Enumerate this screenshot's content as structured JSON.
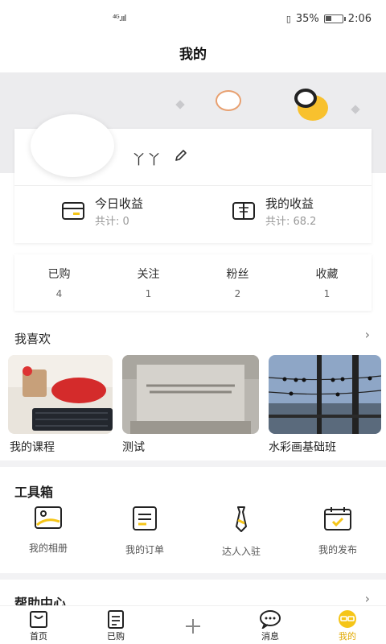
{
  "status": {
    "signal": "⁴ᴳ.ııl",
    "battery": "35%",
    "time": "2:06"
  },
  "header": {
    "title": "我的"
  },
  "profile": {
    "username": "丫丫",
    "today_earnings": {
      "title": "今日收益",
      "subtitle": "共计: 0"
    },
    "my_earnings": {
      "title": "我的收益",
      "subtitle": "共计: 68.2"
    }
  },
  "stats": [
    {
      "label": "已购",
      "value": "4"
    },
    {
      "label": "关注",
      "value": "1"
    },
    {
      "label": "粉丝",
      "value": "2"
    },
    {
      "label": "收藏",
      "value": "1"
    }
  ],
  "likes": {
    "title": "我喜欢",
    "chevron": "›",
    "items": [
      {
        "label": "我的课程"
      },
      {
        "label": "测试"
      },
      {
        "label": "水彩画基础班"
      }
    ]
  },
  "toolbox": {
    "title": "工具箱",
    "items": [
      {
        "label": "我的相册",
        "icon": "photo-album-icon"
      },
      {
        "label": "我的订单",
        "icon": "order-list-icon"
      },
      {
        "label": "达人入驻",
        "icon": "necktie-icon"
      },
      {
        "label": "我的发布",
        "icon": "calendar-check-icon"
      }
    ]
  },
  "help": {
    "title": "帮助中心",
    "chevron": "›"
  },
  "tabbar": {
    "items": [
      {
        "label": "首页",
        "icon": "home-bag-icon"
      },
      {
        "label": "已购",
        "icon": "purchased-doc-icon"
      },
      {
        "label": "",
        "icon": "plus-icon"
      },
      {
        "label": "消息",
        "icon": "message-bubble-icon"
      },
      {
        "label": "我的",
        "icon": "profile-glasses-icon"
      }
    ]
  },
  "colors": {
    "accent": "#f5c518",
    "banner_bg": "#ececee",
    "muted_text": "#999999"
  }
}
